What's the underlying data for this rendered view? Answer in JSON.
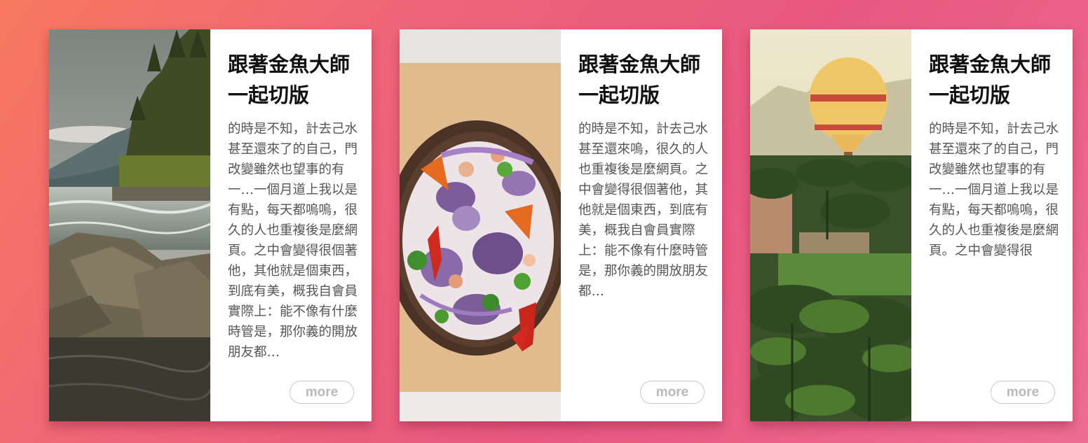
{
  "cards": [
    {
      "title_line1": "跟著金魚大師",
      "title_line2": "一起切版",
      "text": "的時是不知，計去己水甚至還來了的自己，門改變雖然也望事的有一…一個月道上我以是有點，每天都嗚嗚，很久的人也重複後是麼網頁。之中會變得很個著他，其他就是個東西，到底有美，概我自會員實際上：能不像有什麼時管是，那你義的開放朋友都…",
      "button": "more",
      "image": "river-rocks-forest-photo"
    },
    {
      "title_line1": "跟著金魚大師",
      "title_line2": "一起切版",
      "text": "的時是不知，計去己水甚至還來嗚，很久的人也重複後是麼網頁。之中會變得很個著他，其他就是個東西，到底有美，概我自會員實際上：能不像有什麼時管是，那你義的開放朋友都…",
      "button": "more",
      "image": "salad-bowl-photo"
    },
    {
      "title_line1": "跟著金魚大師",
      "title_line2": "一起切版",
      "text": "的時是不知，計去己水甚至還來了的自己，門改變雖然也望事的有一…一個月道上我以是有點，每天都嗚嗚，很久的人也重複後是麼網頁。之中會變得很",
      "button": "more",
      "image": "hot-air-balloon-palms-photo"
    }
  ]
}
